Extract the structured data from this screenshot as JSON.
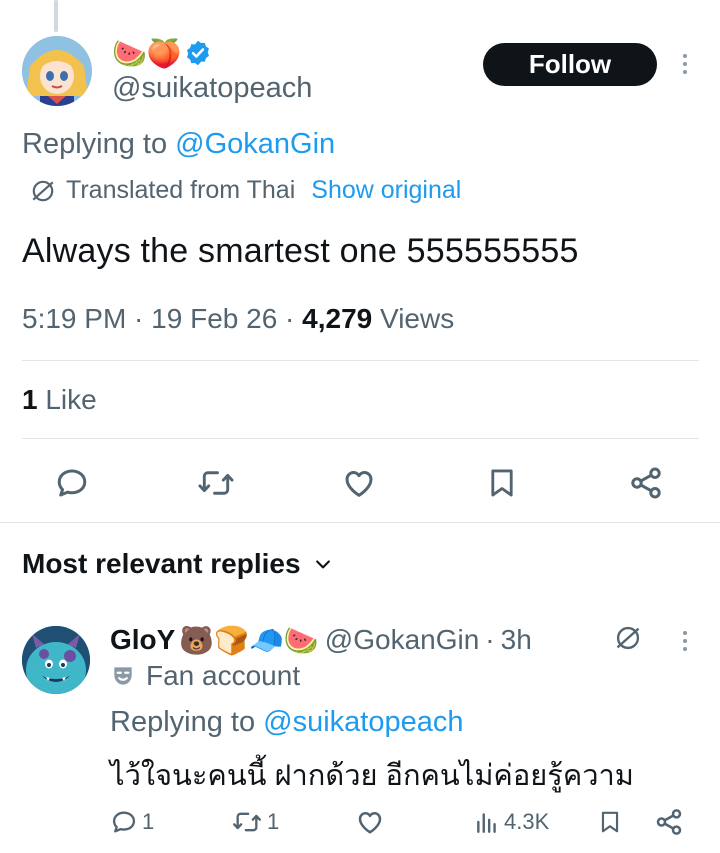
{
  "main_tweet": {
    "name_emoji": "🍉🍑",
    "handle": "@suikatopeach",
    "follow_label": "Follow",
    "replying_prefix": "Replying to ",
    "replying_handle": "@GokanGin",
    "translated_label": "Translated from Thai",
    "show_original_label": "Show original",
    "text": "Always the smartest one 555555555",
    "time": "5:19 PM",
    "date": "19 Feb 26",
    "views_count": "4,279",
    "views_label": "Views",
    "likes_count": "1",
    "likes_label": "Like"
  },
  "replies_section": {
    "title": "Most relevant replies"
  },
  "reply": {
    "name": "GloY",
    "name_emoji": "🐻🍞🧢🍉",
    "handle": "@GokanGin",
    "separator": "·",
    "age": "3h",
    "badge_label": "Fan account",
    "replying_prefix": "Replying to ",
    "replying_handle": "@suikatopeach",
    "text": "ไว้ใจนะคนนี้ ฝากด้วย อีกคนไม่ค่อยรู้ความ",
    "reply_count": "1",
    "retweet_count": "1",
    "views": "4.3K"
  },
  "colors": {
    "accent": "#1d9bf0",
    "muted": "#536471",
    "text": "#0f1419",
    "button_bg": "#0f1419"
  }
}
